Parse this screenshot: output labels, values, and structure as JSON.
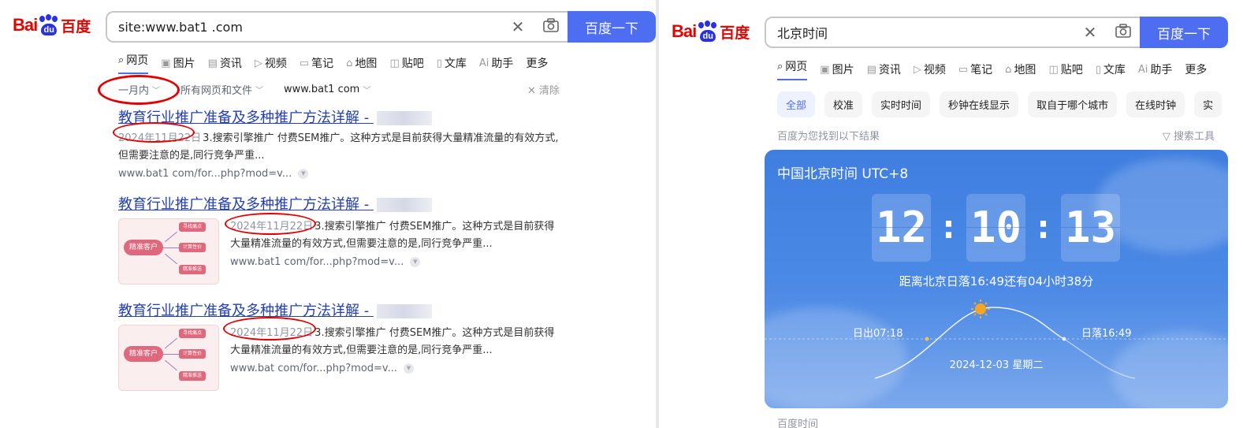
{
  "left": {
    "logo": {
      "bai": "Bai",
      "du": "du",
      "cn": "百度"
    },
    "search": {
      "value": "site:www.bat1     .com",
      "button": "百度一下"
    },
    "tabs": [
      {
        "icon": "search-icon",
        "label": "网页"
      },
      {
        "icon": "image-icon",
        "label": "图片"
      },
      {
        "icon": "news-icon",
        "label": "资讯"
      },
      {
        "icon": "video-icon",
        "label": "视频"
      },
      {
        "icon": "note-icon",
        "label": "笔记"
      },
      {
        "icon": "map-icon",
        "label": "地图"
      },
      {
        "icon": "tieba-icon",
        "label": "贴吧"
      },
      {
        "icon": "doc-icon",
        "label": "文库"
      },
      {
        "icon": "ai-icon",
        "label": "助手"
      },
      {
        "label": "更多"
      }
    ],
    "filters": {
      "time": "一月内",
      "type": "所有网页和文件",
      "site": "www.bat1   com",
      "clear": "清除"
    },
    "results": [
      {
        "title": "教育行业推广准备及多种推广方法详解 - ",
        "date": "2024年11月22日",
        "snippet": "3.搜索引擎推广 付费SEM推广。这种方式是目前获得大量精准流量的有效方式,但需要注意的是,同行竞争严重...",
        "url": "www.bat1     com/for...php?mod=v..."
      },
      {
        "title": "教育行业推广准备及多种推广方法详解 - ",
        "date": "2024年11月22日",
        "snippet": "3.搜索引擎推广 付费SEM推广。这种方式是目前获得大量精准流量的有效方式,但需要注意的是,同行竞争严重...",
        "url": "www.bat1     com/for...php?mod=v...",
        "thumb": {
          "core": "精准客户",
          "leaves": [
            "寻找痛点",
            "计算性价",
            "精准推送"
          ]
        }
      },
      {
        "title": "教育行业推广准备及多种推广方法详解 - ",
        "date": "2024年11月22日",
        "snippet": "3.搜索引擎推广 付费SEM推广。这种方式是目前获得大量精准流量的有效方式,但需要注意的是,同行竞争严重...",
        "url": "www.bat     com/for...php?mod=v...",
        "thumb": {
          "core": "精准客户",
          "leaves": [
            "寻找痛点",
            "计算性价",
            "精准推送"
          ]
        }
      }
    ]
  },
  "right": {
    "logo": {
      "bai": "Bai",
      "du": "du",
      "cn": "百度"
    },
    "search": {
      "value": "北京时间",
      "button": "百度一下"
    },
    "tabs": [
      {
        "icon": "search-icon",
        "label": "网页"
      },
      {
        "icon": "image-icon",
        "label": "图片"
      },
      {
        "icon": "news-icon",
        "label": "资讯"
      },
      {
        "icon": "video-icon",
        "label": "视频"
      },
      {
        "icon": "note-icon",
        "label": "笔记"
      },
      {
        "icon": "map-icon",
        "label": "地图"
      },
      {
        "icon": "tieba-icon",
        "label": "贴吧"
      },
      {
        "icon": "doc-icon",
        "label": "文库"
      },
      {
        "icon": "ai-icon",
        "label": "助手"
      },
      {
        "label": "更多"
      }
    ],
    "chips": [
      "全部",
      "校准",
      "实时时间",
      "秒钟在线显示",
      "取自于哪个城市",
      "在线时钟",
      "实"
    ],
    "found": "百度为您找到以下结果",
    "tools": "搜索工具",
    "clock": {
      "title": "中国北京时间 UTC+8",
      "digits": [
        "12",
        "10",
        "13"
      ],
      "sunset_msg": "距离北京日落16:49还有04小时38分",
      "sunrise": "日出07:18",
      "sunset": "日落16:49",
      "date": "2024-12-03   星期二"
    },
    "footer": "百度时间"
  }
}
